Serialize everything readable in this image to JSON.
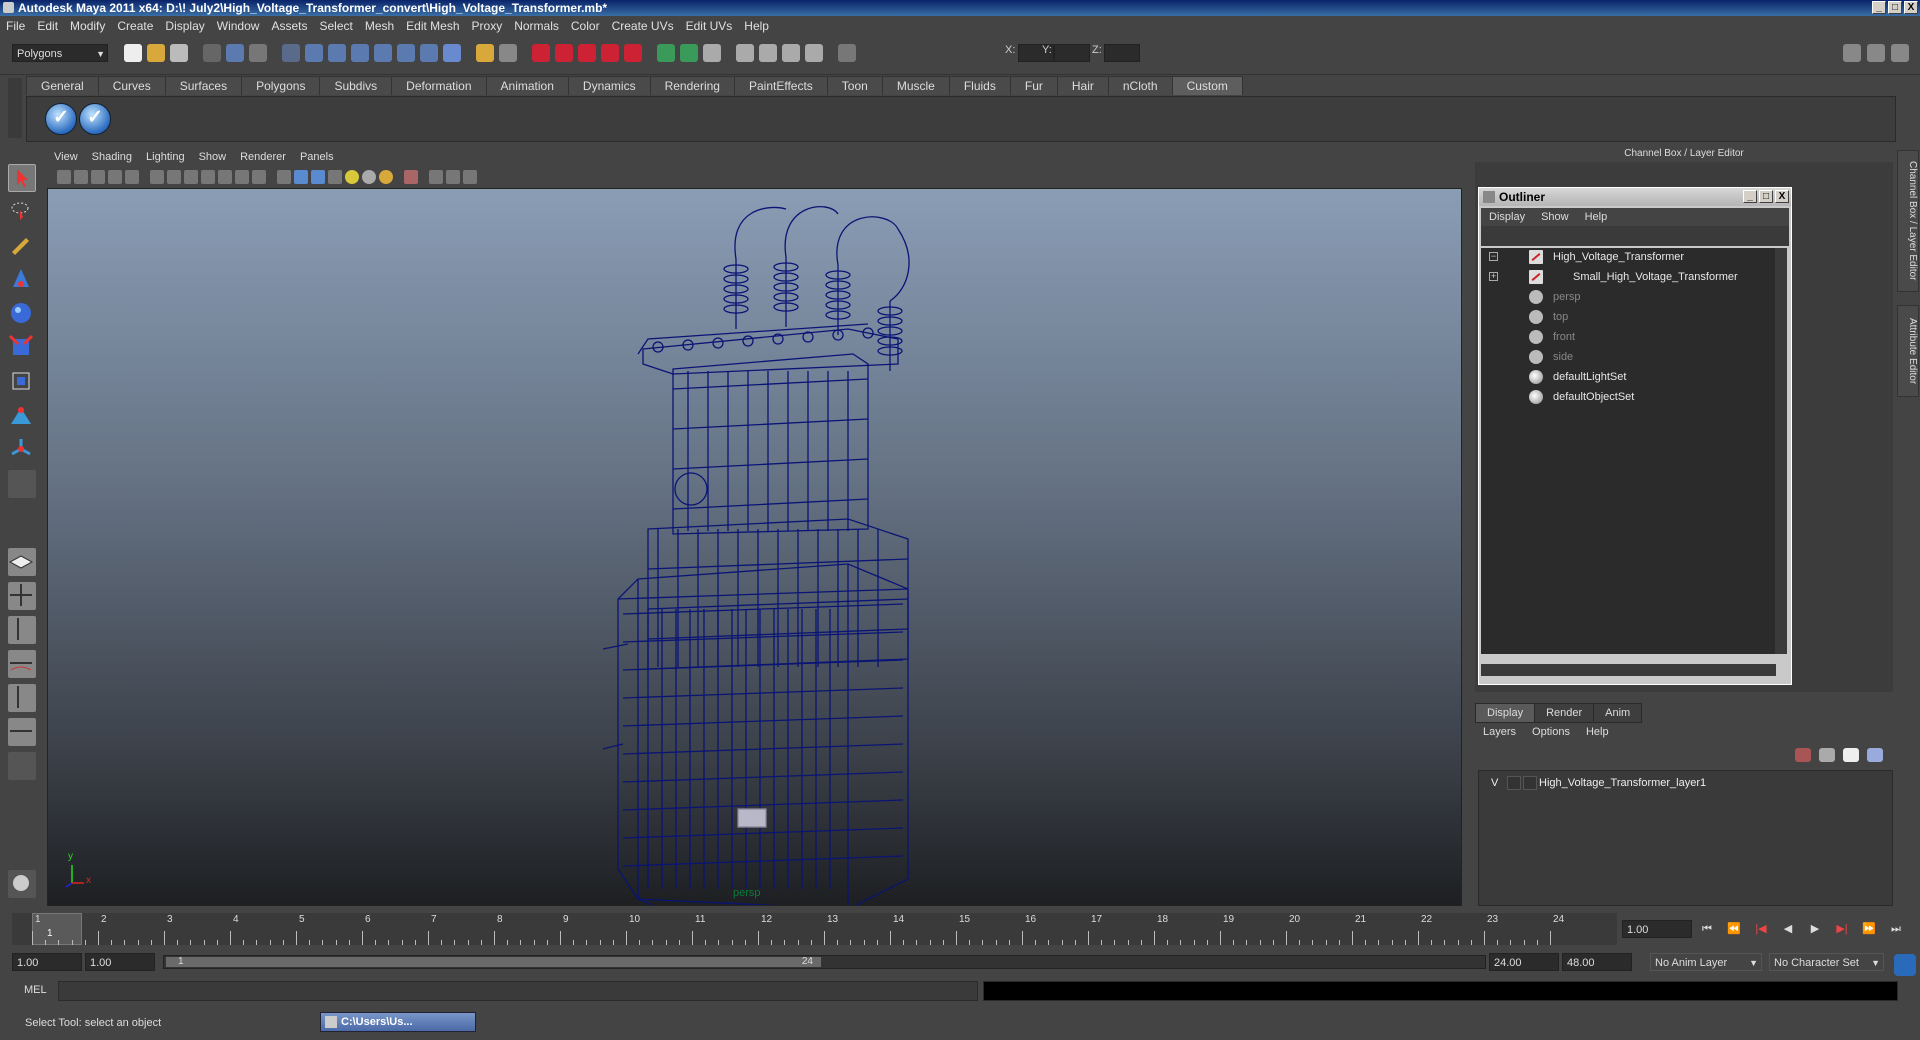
{
  "window": {
    "title": "Autodesk Maya 2011 x64: D:\\! July2\\High_Voltage_Transformer_convert\\High_Voltage_Transformer.mb*",
    "buttons": [
      "_",
      "□",
      "X"
    ]
  },
  "menubar": [
    "File",
    "Edit",
    "Modify",
    "Create",
    "Display",
    "Window",
    "Assets",
    "Select",
    "Mesh",
    "Edit Mesh",
    "Proxy",
    "Normals",
    "Color",
    "Create UVs",
    "Edit UVs",
    "Help"
  ],
  "statusline": {
    "mode": "Polygons",
    "coord_labels": [
      "X:",
      "Y:",
      "Z:"
    ]
  },
  "shelf": {
    "tabs": [
      "General",
      "Curves",
      "Surfaces",
      "Polygons",
      "Subdivs",
      "Deformation",
      "Animation",
      "Dynamics",
      "Rendering",
      "PaintEffects",
      "Toon",
      "Muscle",
      "Fluids",
      "Fur",
      "Hair",
      "nCloth",
      "Custom"
    ],
    "active_tab": "Custom"
  },
  "viewport": {
    "menu": [
      "View",
      "Shading",
      "Lighting",
      "Show",
      "Renderer",
      "Panels"
    ],
    "camera_label": "persp",
    "axis": {
      "y": "y",
      "x": "x"
    },
    "wire_color": "#0a1475"
  },
  "channel_box": {
    "title": "Channel Box / Layer Editor"
  },
  "side_tabs": [
    "Channel Box / Layer Editor",
    "Attribute Editor"
  ],
  "outliner": {
    "title": "Outliner",
    "menu": [
      "Display",
      "Show",
      "Help"
    ],
    "items": [
      {
        "label": "High_Voltage_Transformer",
        "type": "mesh",
        "expander": "−",
        "dim": false
      },
      {
        "label": "Small_High_Voltage_Transformer",
        "type": "mesh",
        "expander": "+",
        "dim": false
      },
      {
        "label": "persp",
        "type": "camera",
        "dim": true
      },
      {
        "label": "top",
        "type": "camera",
        "dim": true
      },
      {
        "label": "front",
        "type": "camera",
        "dim": true
      },
      {
        "label": "side",
        "type": "camera",
        "dim": true
      },
      {
        "label": "defaultLightSet",
        "type": "set",
        "dim": false
      },
      {
        "label": "defaultObjectSet",
        "type": "set",
        "dim": false
      }
    ]
  },
  "layer_editor": {
    "tabs": [
      "Display",
      "Render",
      "Anim"
    ],
    "active_tab": "Display",
    "menu": [
      "Layers",
      "Options",
      "Help"
    ],
    "layers": [
      {
        "visible": "V",
        "name": "High_Voltage_Transformer_layer1"
      }
    ]
  },
  "time_slider": {
    "ticks": [
      "1",
      "2",
      "3",
      "4",
      "5",
      "6",
      "7",
      "8",
      "9",
      "10",
      "11",
      "12",
      "13",
      "14",
      "15",
      "16",
      "17",
      "18",
      "19",
      "20",
      "21",
      "22",
      "23",
      "24"
    ],
    "current_marker": "1",
    "current_frame": "1.00",
    "controls": [
      "⏮",
      "⏪",
      "|◀",
      "◀",
      "▶",
      "▶|",
      "⏩",
      "⏭"
    ]
  },
  "range_slider": {
    "start": "1.00",
    "playback_start": "1.00",
    "range_start_label": "1",
    "range_end_label": "24",
    "playback_end": "24.00",
    "end": "48.00",
    "anim_layer": "No Anim Layer",
    "character_set": "No Character Set"
  },
  "command_line": {
    "label": "MEL"
  },
  "help_line": {
    "text": "Select Tool: select an object",
    "task_window": "C:\\Users\\Us..."
  }
}
